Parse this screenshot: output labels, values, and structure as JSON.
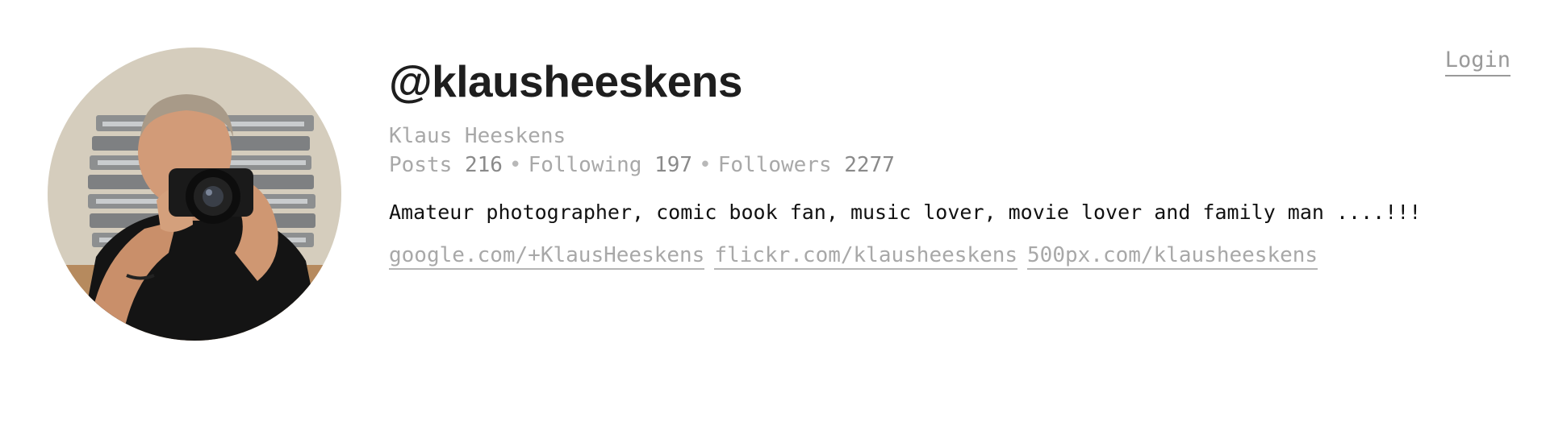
{
  "header": {
    "login_label": "Login"
  },
  "profile": {
    "handle": "@klausheeskens",
    "full_name": "Klaus Heeskens",
    "stats": {
      "posts_label": "Posts",
      "posts_count": "216",
      "following_label": "Following",
      "following_count": "197",
      "followers_label": "Followers",
      "followers_count": "2277",
      "separator": "•"
    },
    "bio": "Amateur photographer, comic book fan, music lover, movie lover and family man ....!!!",
    "links": [
      {
        "label": "google.com/+KlausHeeskens"
      },
      {
        "label": "flickr.com/klausheeskens"
      },
      {
        "label": "500px.com/klausheeskens"
      }
    ]
  }
}
